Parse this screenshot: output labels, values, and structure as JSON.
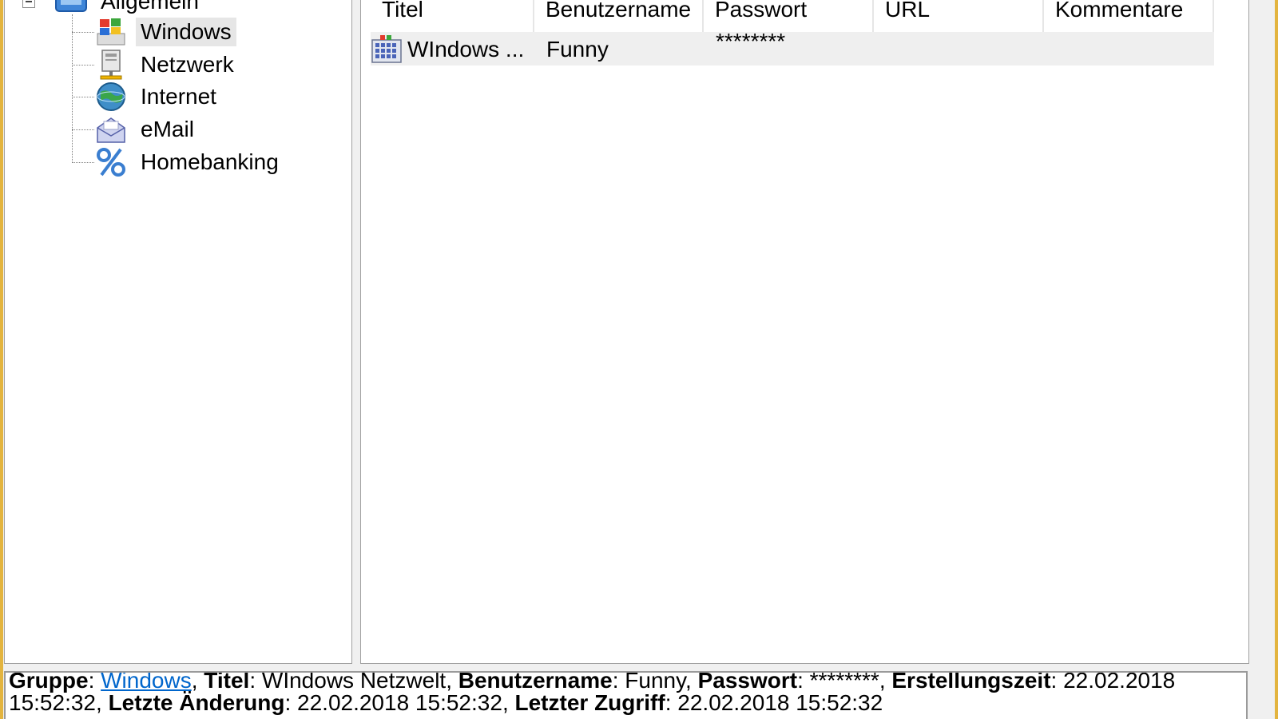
{
  "tree": {
    "root": {
      "label": "Allgemein",
      "icon": "folder-icon"
    },
    "items": [
      {
        "label": "Windows",
        "icon": "windows-flag-icon",
        "selected": true
      },
      {
        "label": "Netzwerk",
        "icon": "network-computer-icon"
      },
      {
        "label": "Internet",
        "icon": "globe-icon"
      },
      {
        "label": "eMail",
        "icon": "envelope-icon"
      },
      {
        "label": "Homebanking",
        "icon": "percent-icon"
      }
    ]
  },
  "list": {
    "columns": [
      "Titel",
      "Benutzername",
      "Passwort",
      "URL",
      "Kommentare"
    ],
    "rows": [
      {
        "title": "WIndows ...",
        "username": "Funny",
        "password": "********",
        "url": "",
        "comment": "",
        "icon": "entry-icon"
      }
    ]
  },
  "details": {
    "group_label": "Gruppe",
    "group_value": "Windows",
    "title_label": "Titel",
    "title_value": "WIndows Netzwelt",
    "username_label": "Benutzername",
    "username_value": "Funny",
    "password_label": "Passwort",
    "password_value": "********",
    "created_label": "Erstellungszeit",
    "created_value": "22.02.2018 15:52:32",
    "modified_label": "Letzte Änderung",
    "modified_value": "22.02.2018 15:52:32",
    "accessed_label": "Letzter Zugriff",
    "accessed_value": "22.02.2018 15:52:32"
  },
  "colors": {
    "frame": "#e3b43f",
    "selection": "#e6e6e6",
    "link": "#0066cc"
  }
}
